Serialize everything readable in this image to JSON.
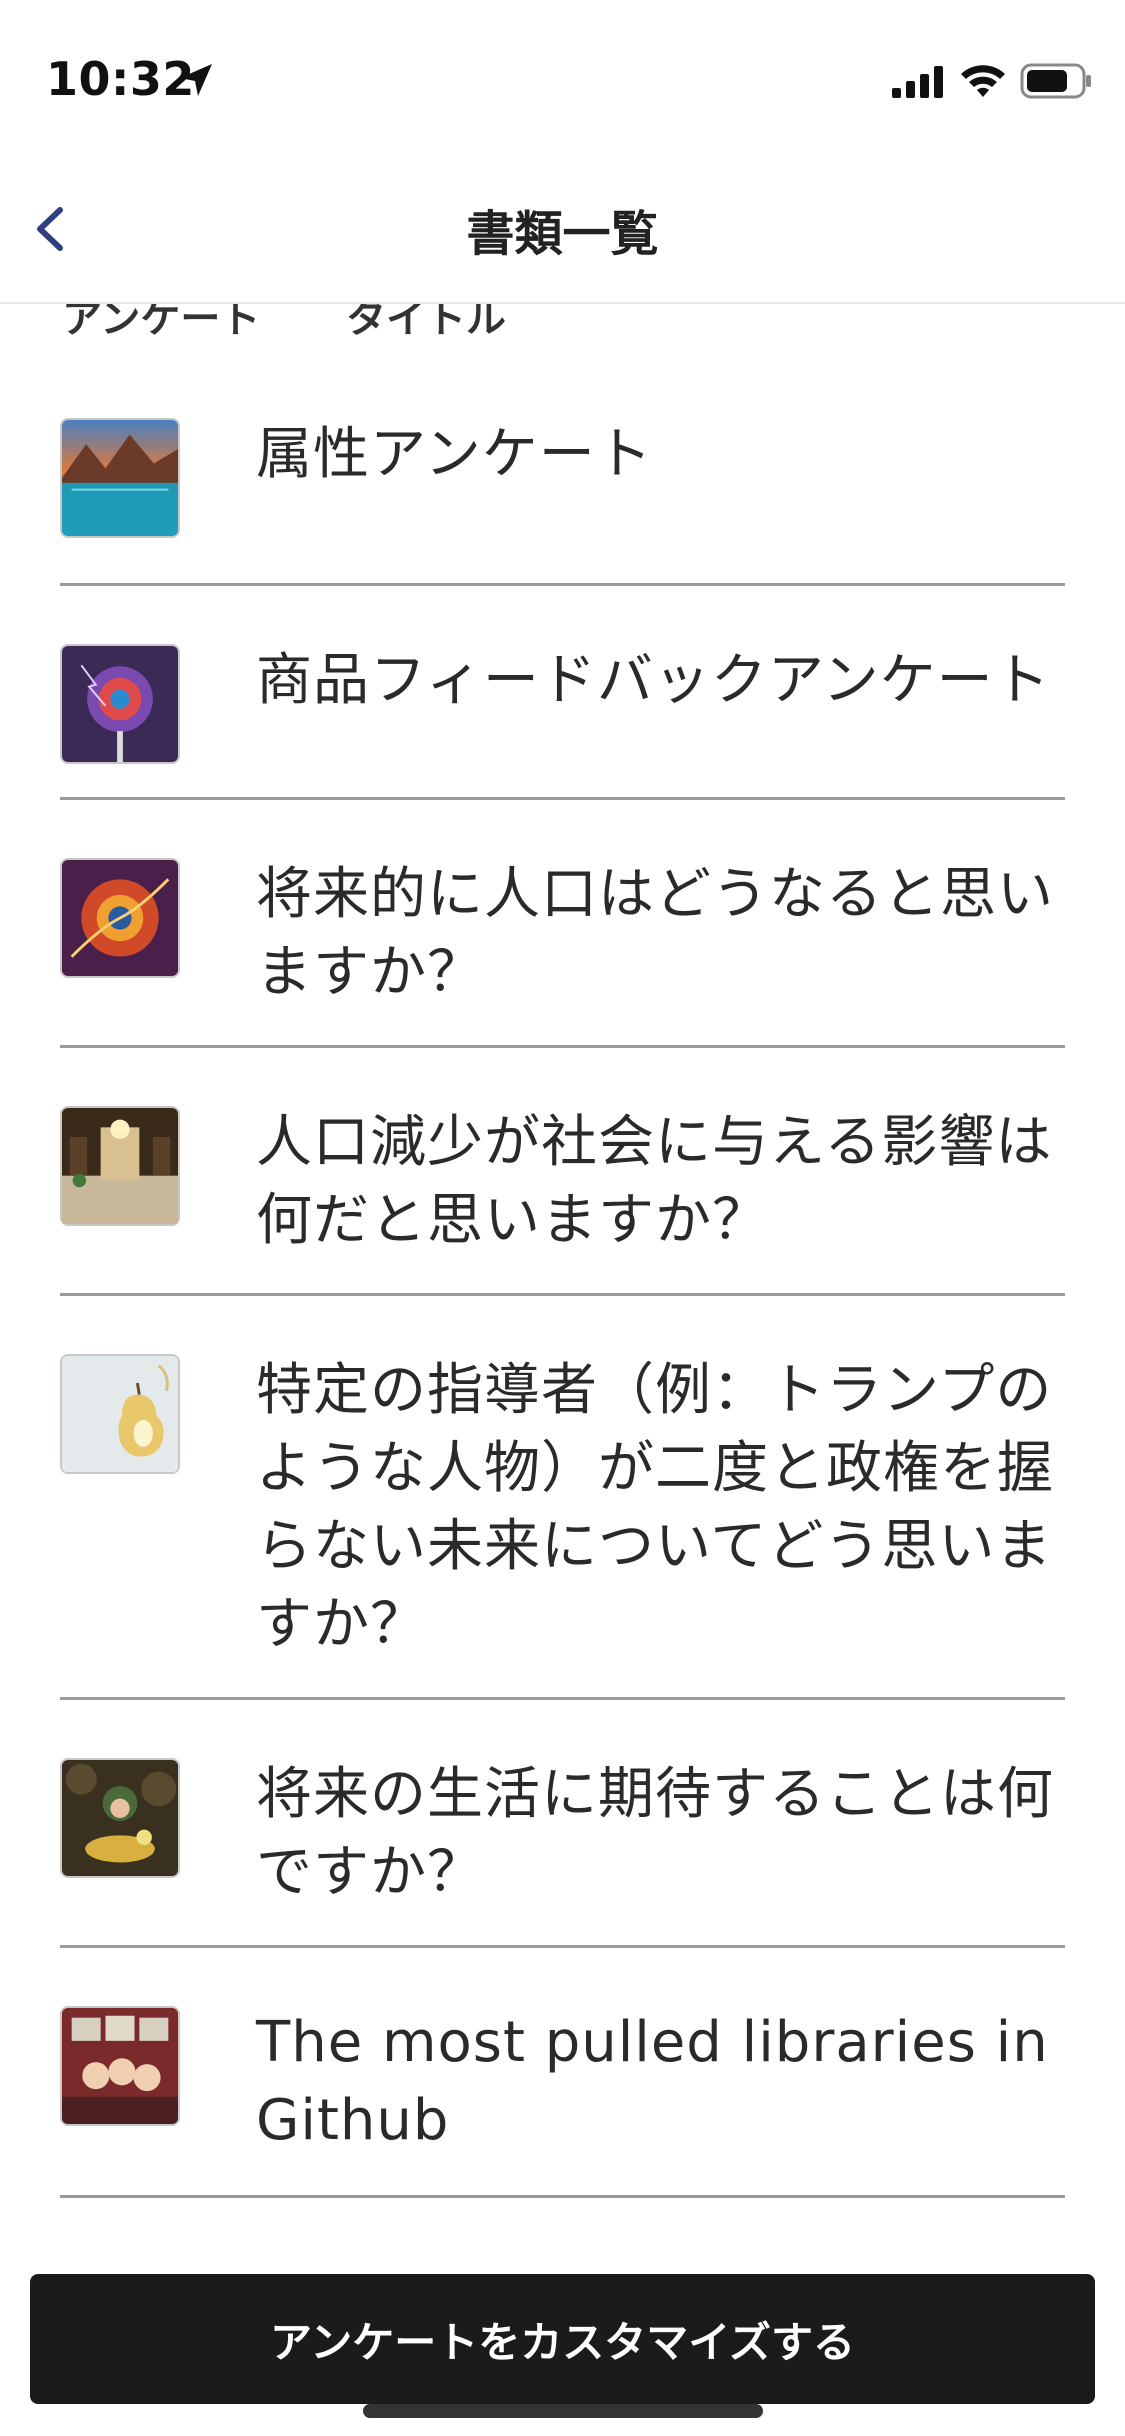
{
  "status_bar": {
    "time": "10:32",
    "icons": [
      "location-arrow-icon",
      "cellular-signal-icon",
      "wifi-icon",
      "battery-icon"
    ]
  },
  "nav": {
    "back_icon": "chevron-left-icon",
    "title": "書類一覧",
    "accent_color": "#2f3f7f"
  },
  "columns": {
    "survey": "アンケート",
    "title": "タイトル"
  },
  "surveys": [
    {
      "title": "属性アンケート",
      "thumbnail": "mountain-lake-thumbnail"
    },
    {
      "title": "商品フィードバックアンケート",
      "thumbnail": "lollipop-lightning-thumbnail"
    },
    {
      "title": "将来的に人口はどうなると思いますか？",
      "thumbnail": "fiery-orb-thumbnail"
    },
    {
      "title": "人口減少が社会に与える影響は何だと思いますか？",
      "thumbnail": "hotel-lobby-thumbnail"
    },
    {
      "title": "特定の指導者（例：トランプのような人物）が二度と政権を握らない未来についてどう思いますか？",
      "thumbnail": "pear-thumbnail"
    },
    {
      "title": "将来の生活に期待することは何ですか？",
      "thumbnail": "child-with-treasure-thumbnail"
    },
    {
      "title": "The most pulled libraries in Github",
      "thumbnail": "anime-characters-thumbnail"
    }
  ],
  "footer": {
    "customize_label": "アンケートをカスタマイズする"
  }
}
